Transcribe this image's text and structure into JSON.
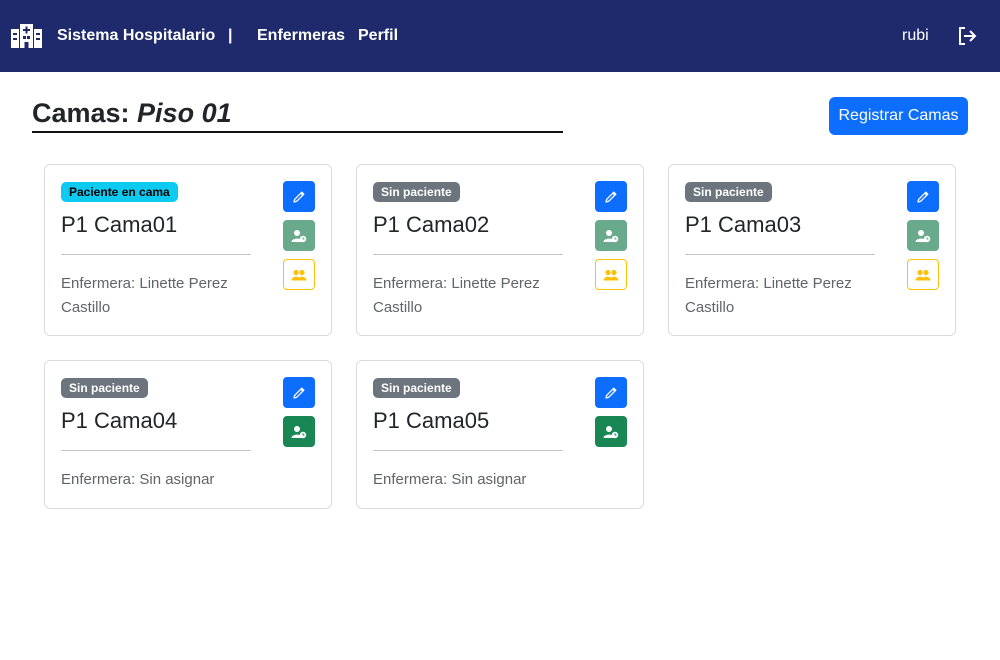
{
  "navbar": {
    "brand": "Sistema Hospitalario",
    "separator": "|",
    "links": [
      {
        "label": "Enfermeras"
      },
      {
        "label": "Perfil"
      }
    ],
    "username": "rubi",
    "icons": {
      "logo": "hospital-building-icon",
      "logout": "logout-icon"
    },
    "background_color": "#1e2a6b"
  },
  "page": {
    "title_prefix": "Camas: ",
    "floor": "Piso 01",
    "register_button": "Registrar Camas"
  },
  "beds": [
    {
      "status": "Paciente en cama",
      "occupied": true,
      "name": "P1 Cama01",
      "nurse": "Enfermera: Linette Perez Castillo",
      "has_nurse": true
    },
    {
      "status": "Sin paciente",
      "occupied": false,
      "name": "P1 Cama02",
      "nurse": "Enfermera: Linette Perez Castillo",
      "has_nurse": true
    },
    {
      "status": "Sin paciente",
      "occupied": false,
      "name": "P1 Cama03",
      "nurse": "Enfermera: Linette Perez Castillo",
      "has_nurse": true
    },
    {
      "status": "Sin paciente",
      "occupied": false,
      "name": "P1 Cama04",
      "nurse": "Enfermera: Sin asignar",
      "has_nurse": false
    },
    {
      "status": "Sin paciente",
      "occupied": false,
      "name": "P1 Cama05",
      "nurse": "Enfermera: Sin asignar",
      "has_nurse": false
    }
  ],
  "colors": {
    "primary": "#0d6efd",
    "success": "#198754",
    "warning": "#ffc107",
    "info": "#0dcaf0",
    "secondary": "#6c757d"
  }
}
